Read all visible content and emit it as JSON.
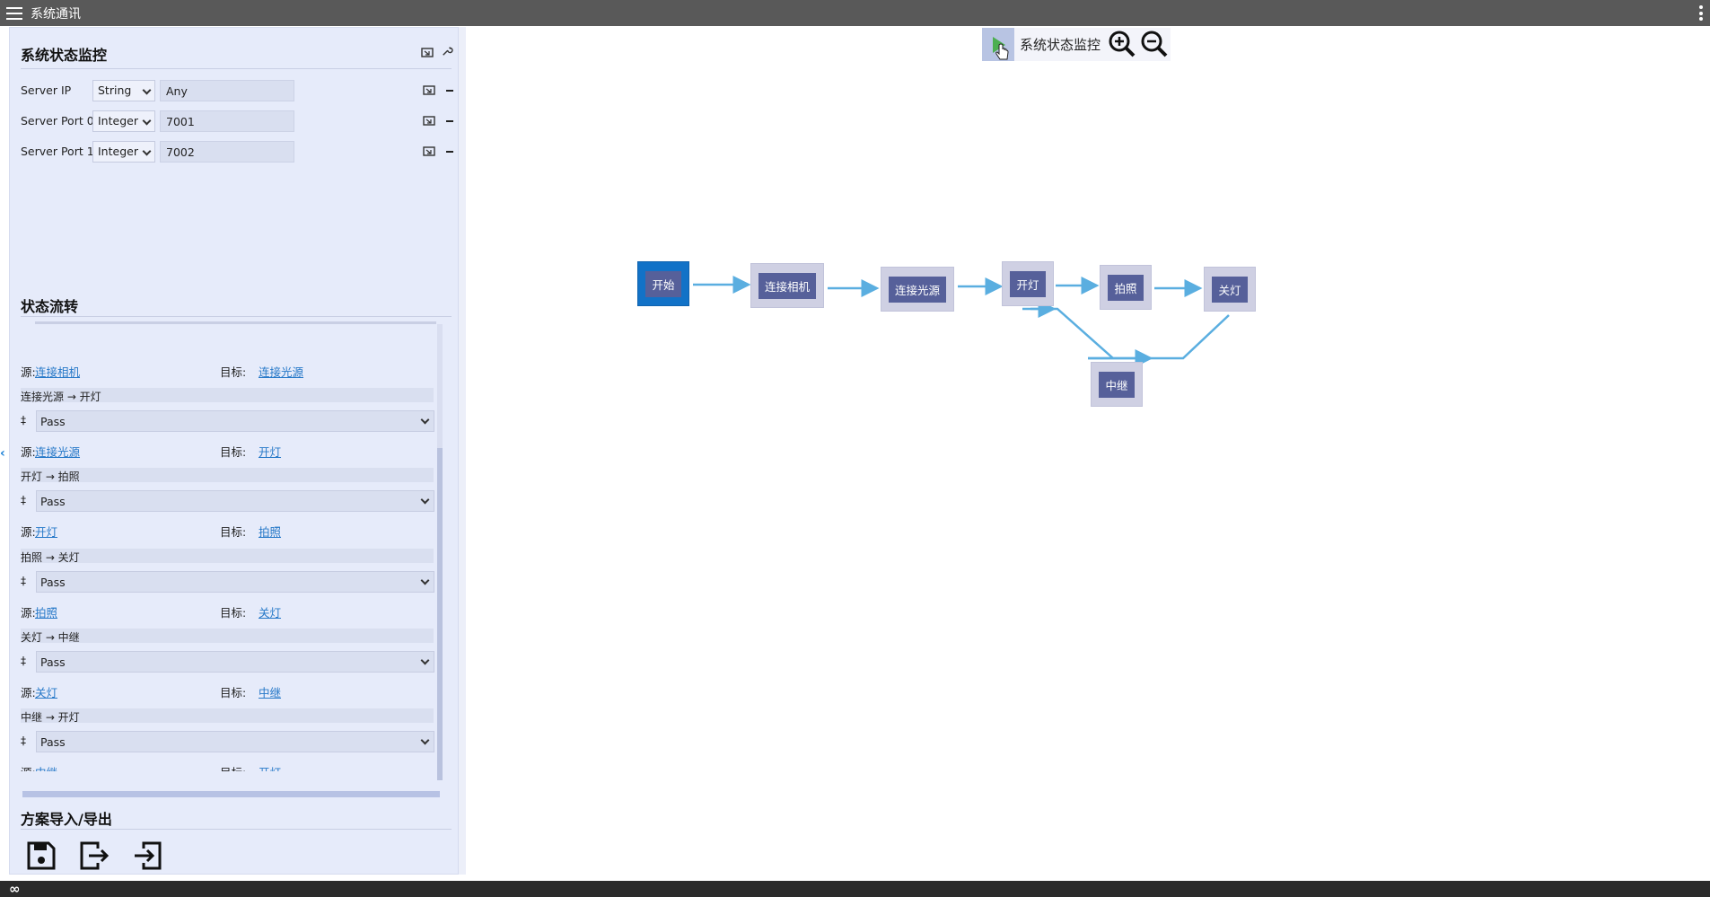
{
  "app": {
    "title": "系统通讯"
  },
  "panel": {
    "title": "系统状态监控",
    "params": [
      {
        "label": "Server IP",
        "type": "String",
        "value": "Any"
      },
      {
        "label": "Server Port 0",
        "type": "Integer",
        "value": "7001"
      },
      {
        "label": "Server Port 1",
        "type": "Integer",
        "value": "7002"
      }
    ],
    "transitions_title": "状态流转",
    "transitions": {
      "first_link": {
        "source_label": "源:",
        "source": "连接相机",
        "target_label": "目标:",
        "target": "连接光源"
      },
      "items": [
        {
          "header": "连接光源 → 开灯",
          "condition": "Pass",
          "source_label": "源:",
          "source": "连接光源",
          "target_label": "目标:",
          "target": "开灯"
        },
        {
          "header": "开灯 → 拍照",
          "condition": "Pass",
          "source_label": "源:",
          "source": "开灯",
          "target_label": "目标:",
          "target": "拍照"
        },
        {
          "header": "拍照 → 关灯",
          "condition": "Pass",
          "source_label": "源:",
          "source": "拍照",
          "target_label": "目标:",
          "target": "关灯"
        },
        {
          "header": "关灯 → 中继",
          "condition": "Pass",
          "source_label": "源:",
          "source": "关灯",
          "target_label": "目标:",
          "target": "中继"
        },
        {
          "header": "中继 → 开灯",
          "condition": "Pass",
          "source_label": "源:",
          "source": "中继",
          "target_label": "目标:",
          "target": "开灯"
        }
      ],
      "condition_tick": "‡"
    },
    "export_title": "方案导入/导出"
  },
  "toolbar": {
    "run_label": "系统状态监控"
  },
  "flow": {
    "nodes": [
      "开始",
      "连接相机",
      "连接光源",
      "开灯",
      "拍照",
      "关灯",
      "中继"
    ],
    "edge_color": "#5aaee0",
    "active_color": "#1272c7"
  }
}
